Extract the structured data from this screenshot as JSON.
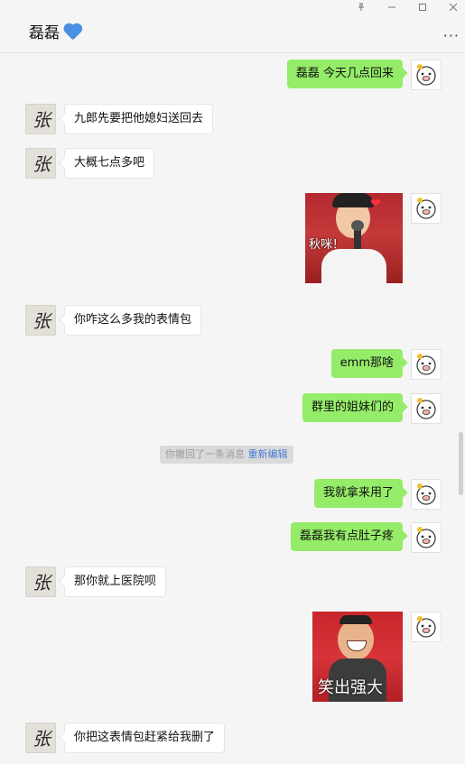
{
  "window": {
    "pin_icon": "pin-icon",
    "minimize_icon": "minimize-icon",
    "maximize_icon": "maximize-icon",
    "close_icon": "close-icon"
  },
  "header": {
    "title": "磊磊",
    "title_emoji": "blue-heart-icon",
    "more_label": "···"
  },
  "messages": [
    {
      "side": "right",
      "type": "text",
      "text": "磊磊 今天几点回来"
    },
    {
      "side": "left",
      "type": "text",
      "text": "九郎先要把他媳妇送回去"
    },
    {
      "side": "left",
      "type": "text",
      "text": "大概七点多吧"
    },
    {
      "side": "right",
      "type": "sticker",
      "caption": "秋咪！"
    },
    {
      "side": "left",
      "type": "text",
      "text": "你咋这么多我的表情包"
    },
    {
      "side": "right",
      "type": "text",
      "text": "emm那啥"
    },
    {
      "side": "right",
      "type": "text",
      "text": "群里的姐妹们的"
    },
    {
      "side": "system",
      "type": "recall",
      "text": "你撤回了一条消息",
      "action": "重新编辑"
    },
    {
      "side": "right",
      "type": "text",
      "text": "我就拿来用了"
    },
    {
      "side": "right",
      "type": "text",
      "text": "磊磊我有点肚子疼"
    },
    {
      "side": "left",
      "type": "text",
      "text": "那你就上医院呗"
    },
    {
      "side": "right",
      "type": "sticker",
      "caption": "笑出强大"
    },
    {
      "side": "left",
      "type": "text",
      "text": "你把这表情包赶紧给我删了"
    }
  ],
  "avatars": {
    "contact_glyph": "张"
  },
  "colors": {
    "sent_bubble": "#95ec69",
    "received_bubble": "#ffffff",
    "link": "#4a7bd6"
  }
}
